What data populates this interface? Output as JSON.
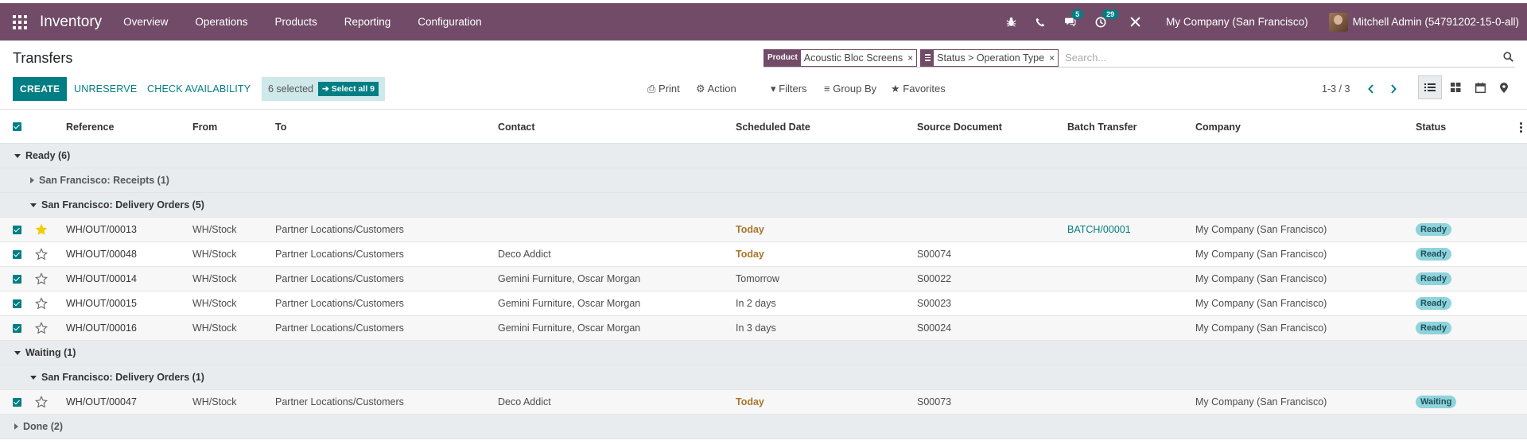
{
  "navbar": {
    "app_name": "Inventory",
    "menu": [
      "Overview",
      "Operations",
      "Products",
      "Reporting",
      "Configuration"
    ],
    "messages_badge": "5",
    "activities_badge": "29",
    "company": "My Company (San Francisco)",
    "user": "Mitchell Admin (54791202-15-0-all)"
  },
  "control_panel": {
    "title": "Transfers",
    "facets": [
      {
        "label": "Product",
        "value": "Acoustic Bloc Screens"
      },
      {
        "value": "Status > Operation Type"
      }
    ],
    "search_placeholder": "Search...",
    "create_label": "CREATE",
    "unreserve_label": "UNRESERVE",
    "check_availability_label": "CHECK AVAILABILITY",
    "selected_text": "6 selected",
    "select_all_text": "Select all 9",
    "print_label": "Print",
    "action_label": "Action",
    "filters_label": "Filters",
    "group_by_label": "Group By",
    "favorites_label": "Favorites",
    "pager_text": "1-3 / 3"
  },
  "table": {
    "columns": [
      "Reference",
      "From",
      "To",
      "Contact",
      "Scheduled Date",
      "Source Document",
      "Batch Transfer",
      "Company",
      "Status"
    ],
    "groups": {
      "ready": "Ready (6)",
      "sf_receipts": "San Francisco: Receipts (1)",
      "sf_delivery_ready": "San Francisco: Delivery Orders (5)",
      "waiting": "Waiting (1)",
      "sf_delivery_waiting": "San Francisco: Delivery Orders (1)",
      "done": "Done (2)"
    },
    "rows": [
      {
        "ref": "WH/OUT/00013",
        "from": "WH/Stock",
        "to": "Partner Locations/Customers",
        "contact": "",
        "date": "Today",
        "source": "",
        "batch": "BATCH/00001",
        "company": "My Company (San Francisco)",
        "status": "Ready",
        "starred": true
      },
      {
        "ref": "WH/OUT/00048",
        "from": "WH/Stock",
        "to": "Partner Locations/Customers",
        "contact": "Deco Addict",
        "date": "Today",
        "source": "S00074",
        "batch": "",
        "company": "My Company (San Francisco)",
        "status": "Ready",
        "starred": false
      },
      {
        "ref": "WH/OUT/00014",
        "from": "WH/Stock",
        "to": "Partner Locations/Customers",
        "contact": "Gemini Furniture, Oscar Morgan",
        "date": "Tomorrow",
        "source": "S00022",
        "batch": "",
        "company": "My Company (San Francisco)",
        "status": "Ready",
        "starred": false
      },
      {
        "ref": "WH/OUT/00015",
        "from": "WH/Stock",
        "to": "Partner Locations/Customers",
        "contact": "Gemini Furniture, Oscar Morgan",
        "date": "In 2 days",
        "source": "S00023",
        "batch": "",
        "company": "My Company (San Francisco)",
        "status": "Ready",
        "starred": false
      },
      {
        "ref": "WH/OUT/00016",
        "from": "WH/Stock",
        "to": "Partner Locations/Customers",
        "contact": "Gemini Furniture, Oscar Morgan",
        "date": "In 3 days",
        "source": "S00024",
        "batch": "",
        "company": "My Company (San Francisco)",
        "status": "Ready",
        "starred": false
      },
      {
        "ref": "WH/OUT/00047",
        "from": "WH/Stock",
        "to": "Partner Locations/Customers",
        "contact": "Deco Addict",
        "date": "Today",
        "source": "S00073",
        "batch": "",
        "company": "My Company (San Francisco)",
        "status": "Waiting",
        "starred": false
      }
    ]
  },
  "colors": {
    "brand": "#714b67",
    "accent": "#017e84",
    "today": "#a9762c",
    "star": "#f3cc00",
    "status_badge": "#8fd3dc"
  }
}
